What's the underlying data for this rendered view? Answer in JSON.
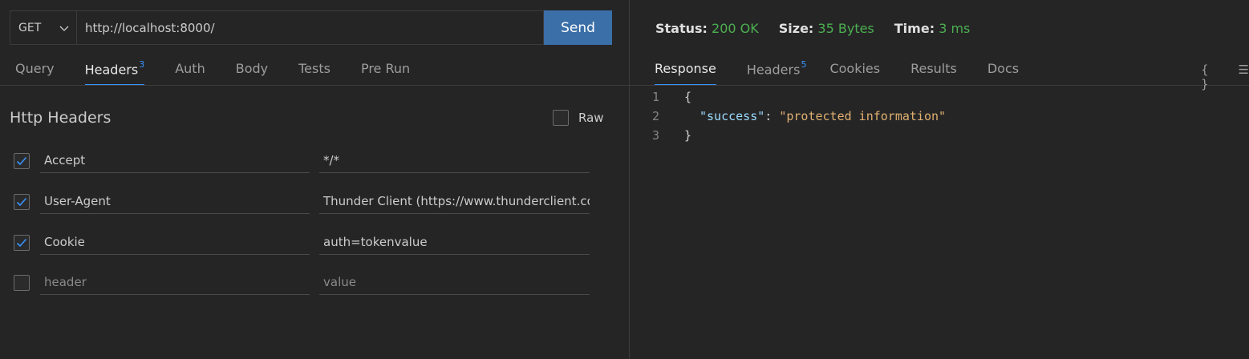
{
  "request": {
    "method": "GET",
    "url": "http://localhost:8000/",
    "send_label": "Send"
  },
  "request_tabs": [
    {
      "label": "Query"
    },
    {
      "label": "Headers",
      "count": "3",
      "active": true
    },
    {
      "label": "Auth"
    },
    {
      "label": "Body"
    },
    {
      "label": "Tests"
    },
    {
      "label": "Pre Run"
    }
  ],
  "headers_section": {
    "title": "Http Headers",
    "raw_label": "Raw",
    "rows": [
      {
        "key": "Accept",
        "value": "*/*",
        "checked": true
      },
      {
        "key": "User-Agent",
        "value": "Thunder Client (https://www.thunderclient.com)",
        "checked": true
      },
      {
        "key": "Cookie",
        "value": "auth=tokenvalue",
        "checked": true
      },
      {
        "key_placeholder": "header",
        "value_placeholder": "value",
        "checked": false
      }
    ]
  },
  "response": {
    "status_label": "Status:",
    "status_value": "200 OK",
    "size_label": "Size:",
    "size_value": "35 Bytes",
    "time_label": "Time:",
    "time_value": "3 ms",
    "tabs": [
      {
        "label": "Response",
        "active": true
      },
      {
        "label": "Headers",
        "count": "5"
      },
      {
        "label": "Cookies"
      },
      {
        "label": "Results"
      },
      {
        "label": "Docs"
      }
    ],
    "icons": [
      "braces-icon",
      "menu-icon"
    ],
    "braces_glyph": "{ }",
    "menu_glyph": "☰",
    "body_lines": [
      {
        "n": "1",
        "open": "{"
      },
      {
        "n": "2",
        "key": "\"success\"",
        "sep": ": ",
        "value": "\"protected information\""
      },
      {
        "n": "3",
        "close": "}"
      }
    ]
  },
  "colors": {
    "accent": "#3794ff",
    "send_button": "#3b6fa8",
    "status_ok": "#4caf50",
    "background": "#252526"
  }
}
